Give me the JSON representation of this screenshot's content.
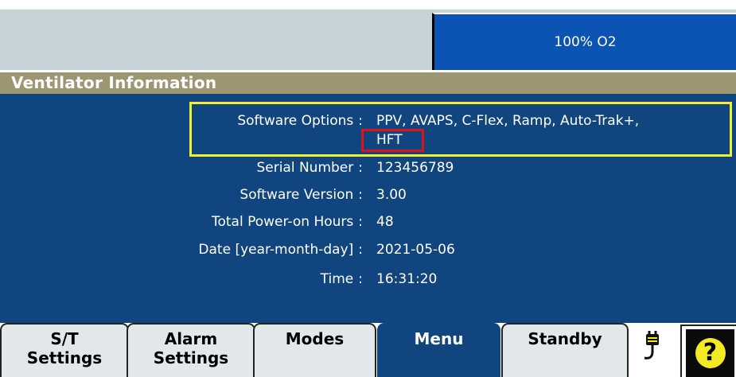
{
  "header": {
    "oxygen_label": "100% O2"
  },
  "title": "Ventilator Information",
  "info": [
    {
      "label": "Software Options",
      "value": "PPV, AVAPS, C-Flex, Ramp, Auto-Trak+,",
      "value2": "HFT"
    },
    {
      "label": "Serial Number",
      "value": "123456789"
    },
    {
      "label": "Software Version",
      "value": "3.00"
    },
    {
      "label": "Total Power-on Hours",
      "value": "48"
    },
    {
      "label": "Date [year-month-day]",
      "value": "2021-05-06"
    },
    {
      "label": "Time",
      "value": "16:31:20"
    }
  ],
  "separator": ":",
  "tabs": [
    {
      "line1": "S/T",
      "line2": "Settings"
    },
    {
      "line1": "Alarm",
      "line2": "Settings"
    },
    {
      "line1": "Modes",
      "line2": ""
    },
    {
      "line1": "Menu",
      "line2": ""
    },
    {
      "line1": "Standby",
      "line2": ""
    }
  ],
  "active_tab": "Menu",
  "help_symbol": "?",
  "icons": {
    "power": "ac-power-plug-icon",
    "help": "help-icon"
  },
  "colors": {
    "panel_blue": "#11457f",
    "title_bar": "#9c9673",
    "oxygen_blue": "#0c54b3",
    "highlight_yellow": "#f0f032",
    "highlight_red": "#e01212",
    "help_yellow": "#f3ea22"
  }
}
